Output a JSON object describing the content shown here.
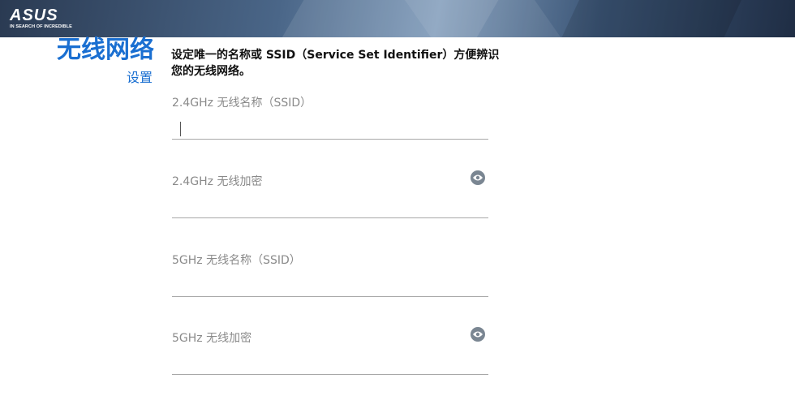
{
  "brand": {
    "logo_text": "ASUS",
    "tagline": "IN SEARCH OF INCREDIBLE"
  },
  "page": {
    "title": "无线网络",
    "subtitle": "设置",
    "description": "设定唯一的名称或 SSID（Service Set Identifier）方便辨识您的无线网络。"
  },
  "fields": [
    {
      "label": "2.4GHz 无线名称（SSID）",
      "value": "",
      "has_visibility_toggle": false,
      "focused": true
    },
    {
      "label": "2.4GHz 无线加密",
      "value": "",
      "has_visibility_toggle": true,
      "icon": "eye-icon"
    },
    {
      "label": "5GHz 无线名称（SSID）",
      "value": "",
      "has_visibility_toggle": false
    },
    {
      "label": "5GHz 无线加密",
      "value": "",
      "has_visibility_toggle": true,
      "icon": "eye-icon"
    }
  ],
  "colors": {
    "accent": "#1a6fd1",
    "label": "#8a8a8a",
    "underline": "#a8a8a8",
    "icon": "#7a8692"
  }
}
